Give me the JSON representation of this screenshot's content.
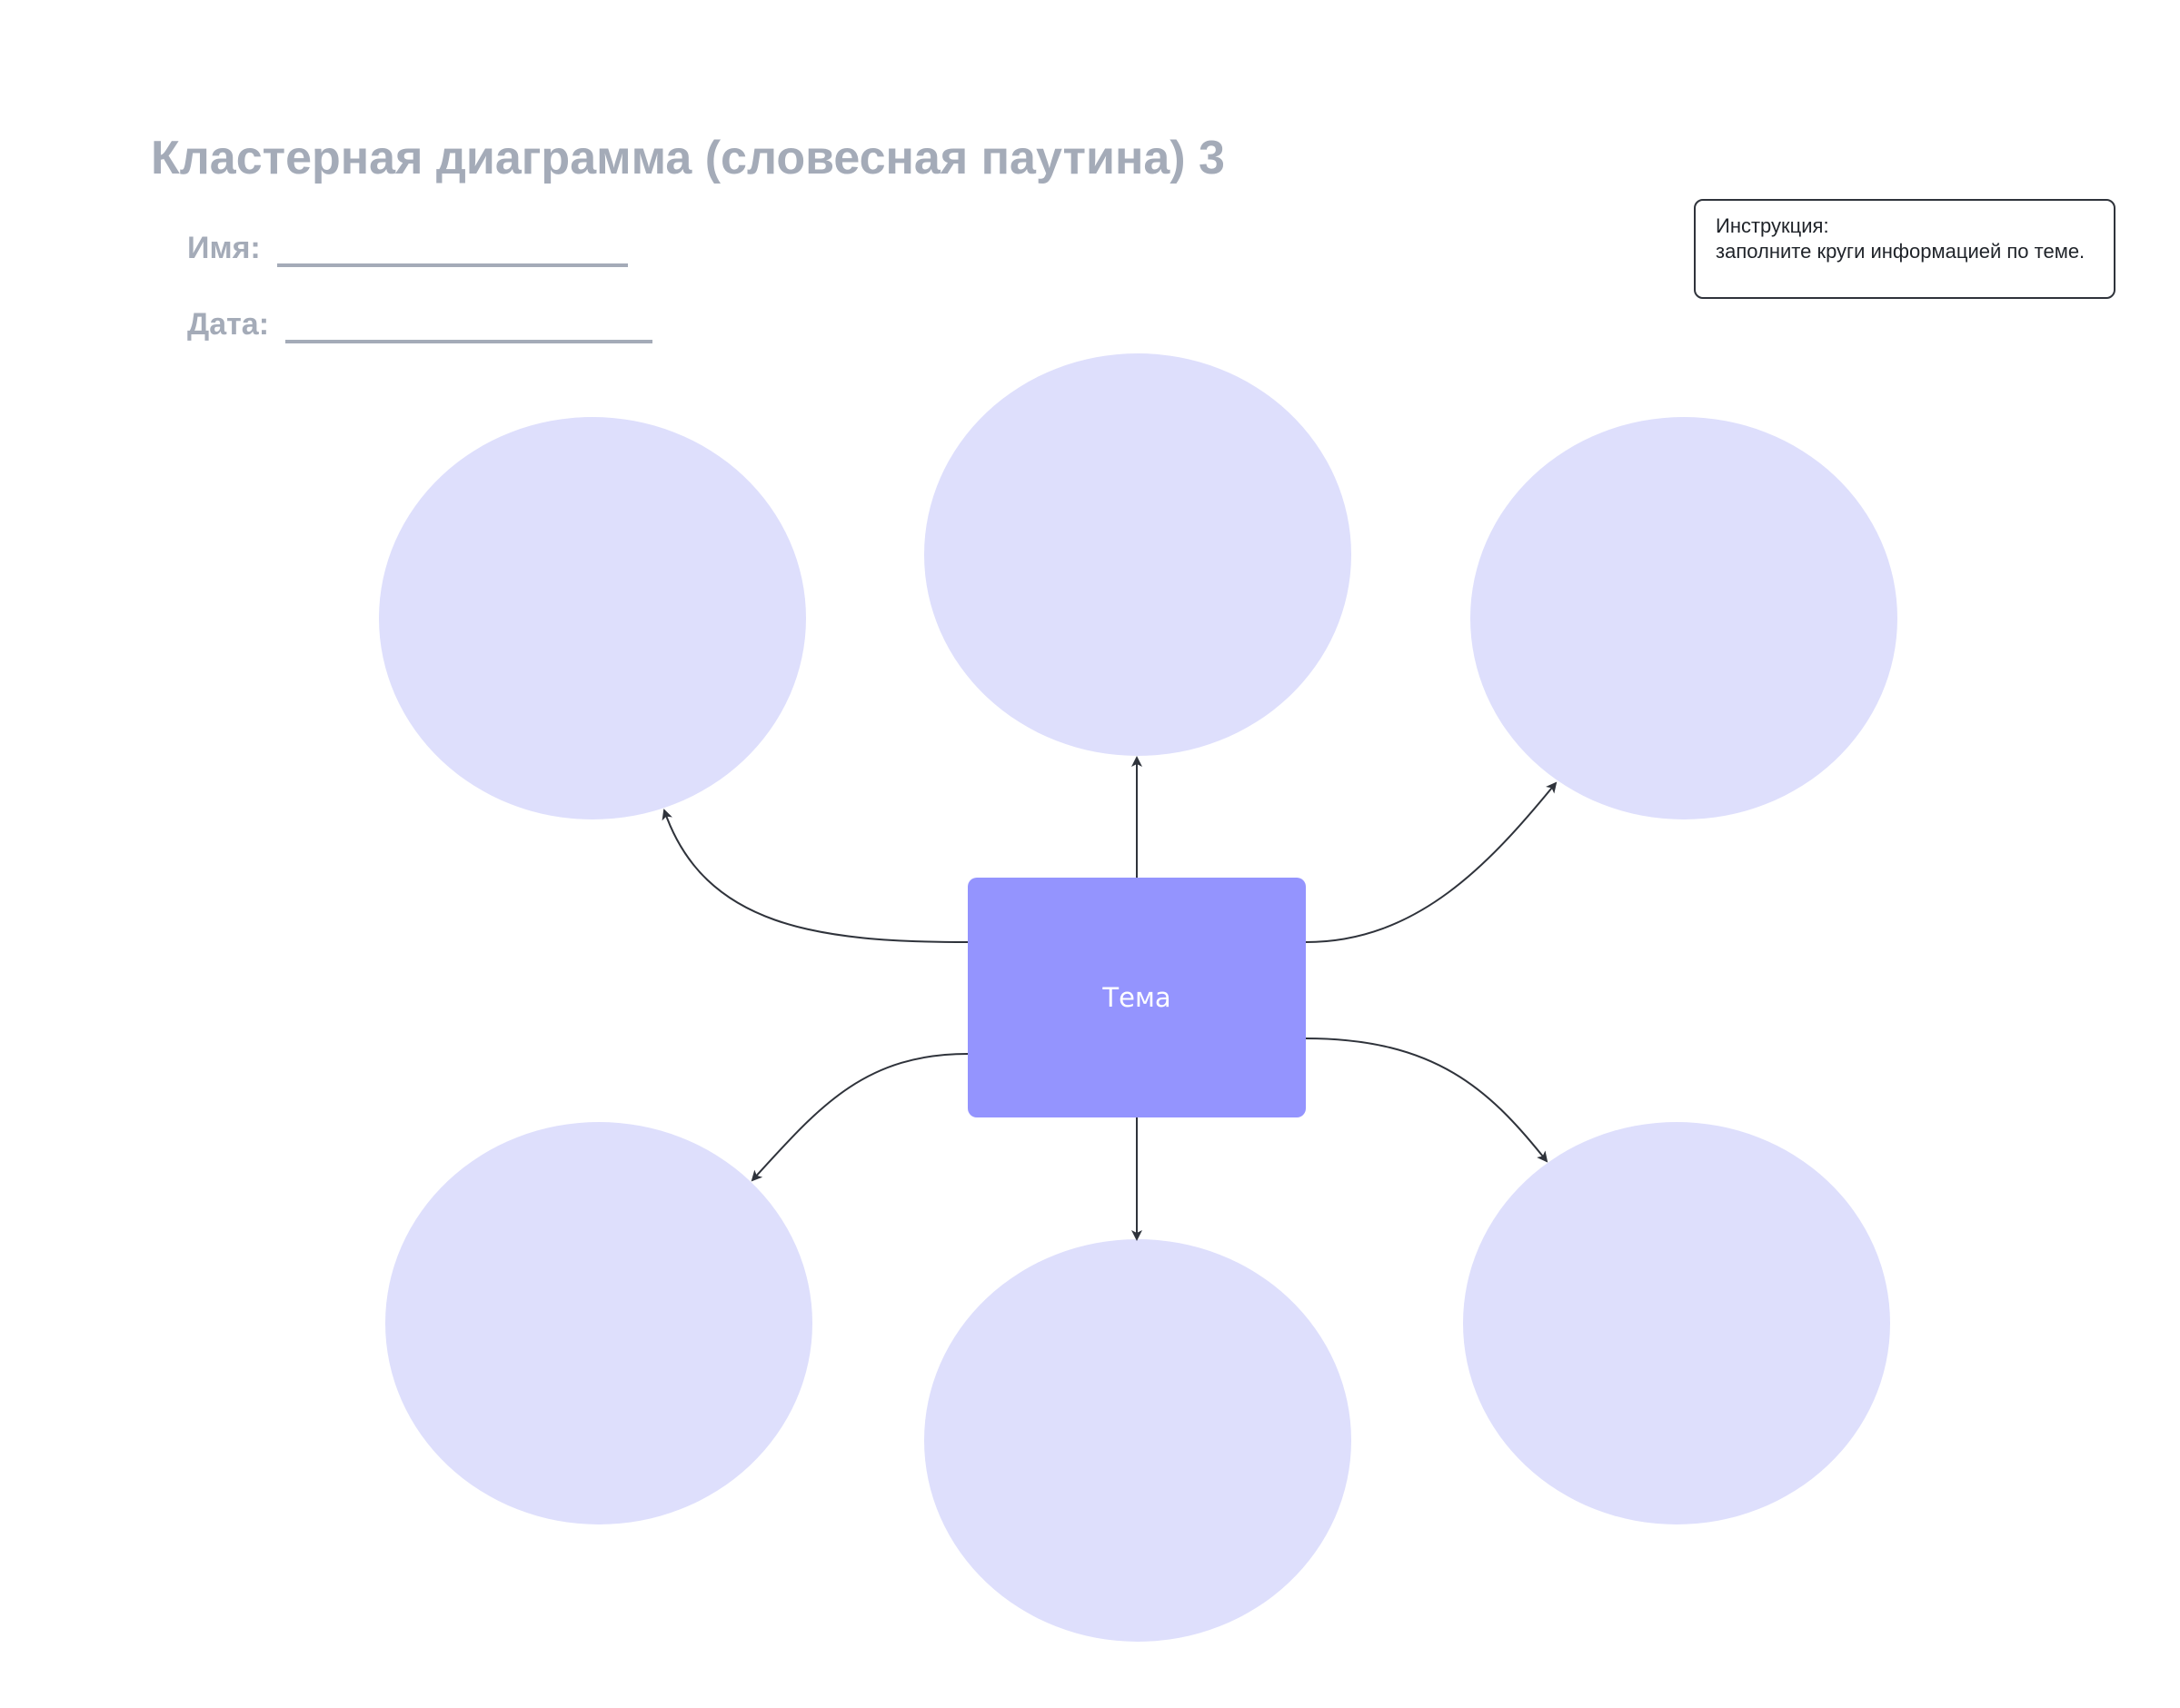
{
  "header": {
    "title": "Кластерная диаграмма (словесная паутина) 3",
    "name_label": "Имя:",
    "date_label": "Дата:"
  },
  "instruction": {
    "title": "Инструкция:",
    "text": "заполните круги информацией по теме."
  },
  "diagram": {
    "center_label": "Тема",
    "bubble_count": 6,
    "colors": {
      "bubble_fill": "#dedffc",
      "center_fill": "#9494fe",
      "center_text": "#ffffff",
      "arrow": "#2f333b",
      "header_text": "#a4abb8"
    }
  }
}
